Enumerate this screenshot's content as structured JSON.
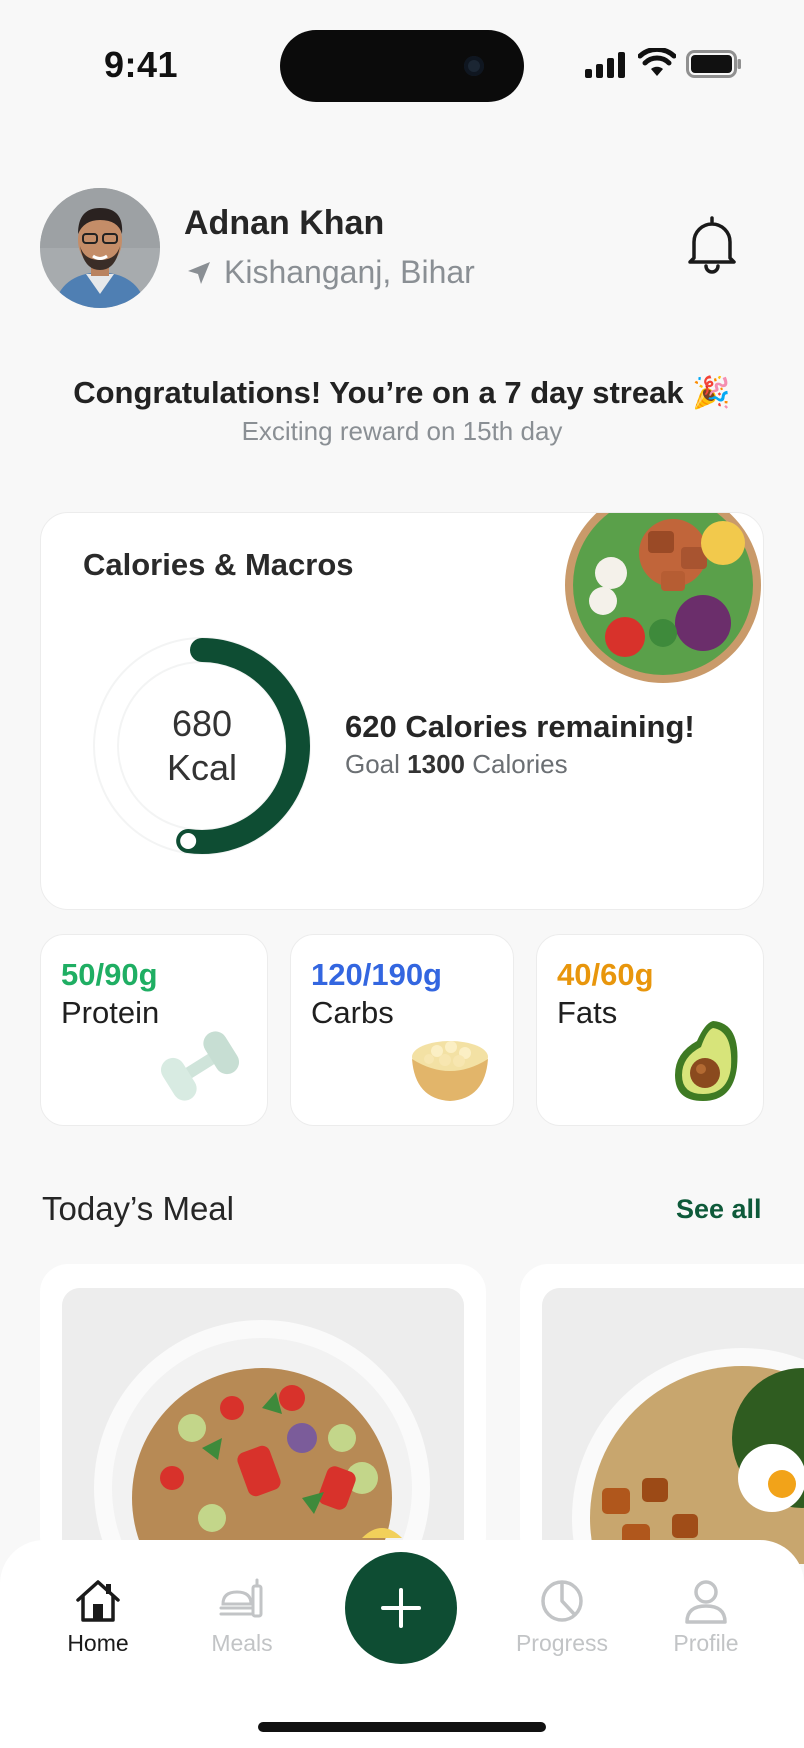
{
  "status_bar": {
    "time": "9:41"
  },
  "header": {
    "user_name": "Adnan Khan",
    "location": "Kishanganj, Bihar",
    "icons": {
      "location": "location-arrow-icon",
      "notification": "bell-icon"
    }
  },
  "streak": {
    "title": "Congratulations! You’re on a 7 day streak 🎉",
    "subtitle": "Exciting reward on 15th day"
  },
  "calories": {
    "title": "Calories & Macros",
    "consumed_value": "680",
    "consumed_unit": "Kcal",
    "remaining_text": "620 Calories remaining!",
    "goal_prefix": "Goal ",
    "goal_value": "1300",
    "goal_suffix": " Calories",
    "progress_fraction": 0.523,
    "ring_color": "#0e4d33"
  },
  "macros": [
    {
      "value": "50/90g",
      "label": "Protein",
      "color": "#1fae63",
      "icon": "dumbbell-icon"
    },
    {
      "value": "120/190g",
      "label": "Carbs",
      "color": "#3366e0",
      "icon": "grain-bowl-icon"
    },
    {
      "value": "40/60g",
      "label": "Fats",
      "color": "#e8960c",
      "icon": "avocado-icon"
    }
  ],
  "meals": {
    "heading": "Today’s Meal",
    "see_all": "See all"
  },
  "nav": {
    "items": [
      {
        "label": "Home",
        "icon": "home-icon",
        "active": true
      },
      {
        "label": "Meals",
        "icon": "meals-icon",
        "active": false
      },
      {
        "label": "Progress",
        "icon": "pie-chart-icon",
        "active": false
      },
      {
        "label": "Profile",
        "icon": "user-icon",
        "active": false
      }
    ],
    "fab_icon": "plus-icon",
    "active_color": "#1a1a1a",
    "inactive_color": "#c2c4c6"
  }
}
